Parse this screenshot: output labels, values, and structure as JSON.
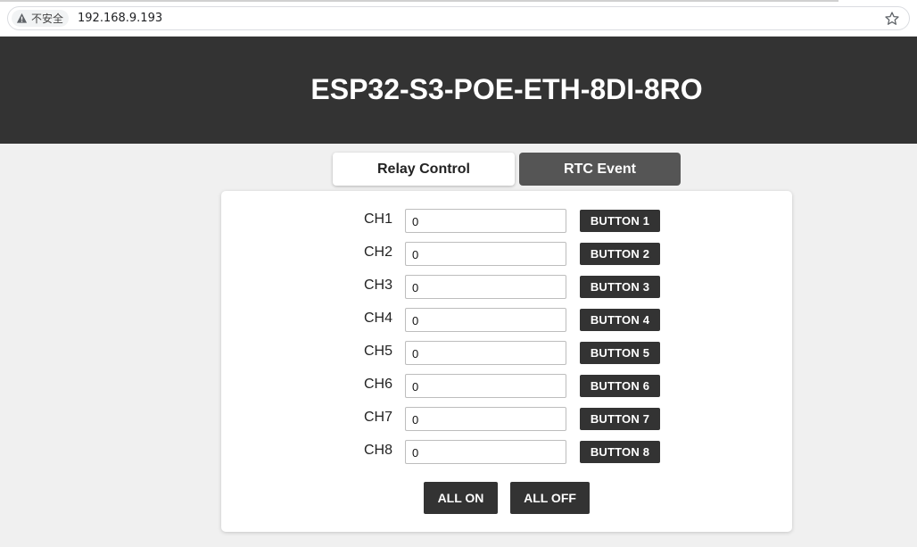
{
  "browser": {
    "security_label": "不安全",
    "url": "192.168.9.193",
    "icons": {
      "security": "warning-triangle-icon",
      "bookmark": "star-icon"
    }
  },
  "header": {
    "title": "ESP32-S3-POE-ETH-8DI-8RO"
  },
  "tabs": [
    {
      "label": "Relay Control",
      "active": true
    },
    {
      "label": "RTC Event",
      "active": false
    }
  ],
  "channels": [
    {
      "label": "CH1",
      "value": "0",
      "button": "BUTTON 1"
    },
    {
      "label": "CH2",
      "value": "0",
      "button": "BUTTON 2"
    },
    {
      "label": "CH3",
      "value": "0",
      "button": "BUTTON 3"
    },
    {
      "label": "CH4",
      "value": "0",
      "button": "BUTTON 4"
    },
    {
      "label": "CH5",
      "value": "0",
      "button": "BUTTON 5"
    },
    {
      "label": "CH6",
      "value": "0",
      "button": "BUTTON 6"
    },
    {
      "label": "CH7",
      "value": "0",
      "button": "BUTTON 7"
    },
    {
      "label": "CH8",
      "value": "0",
      "button": "BUTTON 8"
    }
  ],
  "actions": {
    "all_on": "ALL ON",
    "all_off": "ALL OFF"
  },
  "colors": {
    "header_bg": "#333333",
    "button_bg": "#333333",
    "inactive_tab_bg": "#555555",
    "page_bg": "#f0f0f0"
  }
}
